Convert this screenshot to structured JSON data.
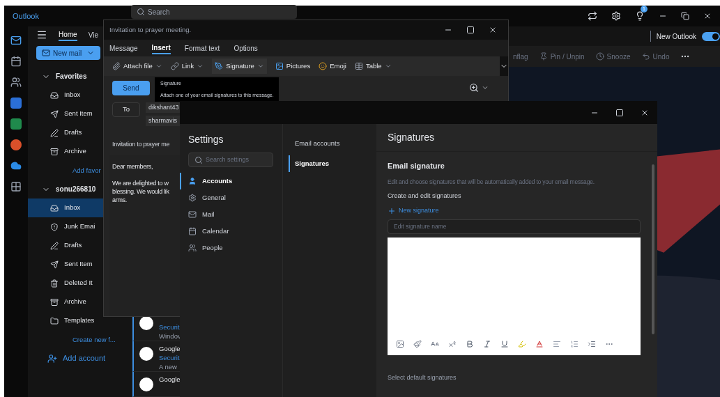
{
  "outlook": {
    "app_name": "Outlook",
    "search_placeholder": "Search",
    "notification_count": "1",
    "ribbon_tabs": [
      {
        "label": "Home",
        "selected": true
      },
      {
        "label": "Vie",
        "selected": false
      }
    ],
    "new_mail": "New mail",
    "new_outlook": {
      "label": "New Outlook",
      "on": true
    },
    "ribbon_actions": [
      "nflag",
      "Pin / Unpin",
      "Snooze",
      "Undo"
    ],
    "folder_groups": [
      {
        "label": "Favorites",
        "expanded": true,
        "children": [
          {
            "label": "Inbox",
            "selected": false
          },
          {
            "label": "Sent Item",
            "selected": false
          },
          {
            "label": "Drafts",
            "selected": false
          },
          {
            "label": "Archive",
            "selected": false
          }
        ],
        "link": "Add favor"
      },
      {
        "label": "sonu266810",
        "expanded": true,
        "children": [
          {
            "label": "Inbox",
            "selected": true
          },
          {
            "label": "Junk Emai",
            "selected": false
          },
          {
            "label": "Drafts",
            "selected": false
          },
          {
            "label": "Sent Item",
            "selected": false
          },
          {
            "label": "Deleted It",
            "selected": false
          },
          {
            "label": "Archive",
            "selected": false
          },
          {
            "label": "Templates",
            "selected": false
          }
        ],
        "link": "Create new f..."
      }
    ],
    "add_account": "Add account",
    "messages": [
      {
        "subject": "Securit",
        "preview": "Windov"
      },
      {
        "sender": "Google",
        "subject": "Securit",
        "preview": "A new"
      },
      {
        "sender": "Google"
      }
    ]
  },
  "compose": {
    "title": "Invitation to prayer meeting.",
    "tabs": [
      {
        "label": "Message",
        "selected": false
      },
      {
        "label": "Insert",
        "selected": true
      },
      {
        "label": "Format text",
        "selected": false
      },
      {
        "label": "Options",
        "selected": false
      }
    ],
    "toolbar": [
      "Attach file",
      "Link",
      "Signature",
      "Pictures",
      "Emoji",
      "Table"
    ],
    "tooltip": {
      "title": "Signature",
      "text": "Attach one of your email signatures to this message."
    },
    "send": "Send",
    "to": "To",
    "recipients": [
      "dikshant43",
      "sharmavis"
    ],
    "subject": "Invitation to prayer me",
    "body": [
      "Dear members,",
      "We are delighted to w",
      "blessing. We would lik",
      "arms."
    ]
  },
  "settings": {
    "title": "Settings",
    "search_placeholder": "Search settings",
    "nav": [
      {
        "label": "Accounts",
        "selected": true
      },
      {
        "label": "General",
        "selected": false
      },
      {
        "label": "Mail",
        "selected": false
      },
      {
        "label": "Calendar",
        "selected": false
      },
      {
        "label": "People",
        "selected": false
      }
    ],
    "subnav": [
      {
        "label": "Email accounts",
        "selected": false
      },
      {
        "label": "Signatures",
        "selected": true
      }
    ],
    "heading": "Signatures",
    "section": "Email signature",
    "description": "Edit and choose signatures that will be automatically added to your email message.",
    "create_label": "Create and edit signatures",
    "new_signature": "New signature",
    "name_placeholder": "Edit signature name",
    "default_label": "Select default signatures"
  }
}
